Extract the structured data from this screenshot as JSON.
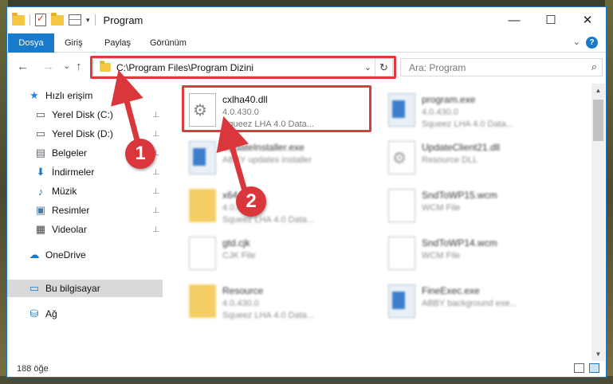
{
  "window": {
    "title": "Program",
    "controls": {
      "minimize": "—",
      "maximize": "☐",
      "close": "✕"
    }
  },
  "ribbon": {
    "tabs": [
      "Dosya",
      "Giriş",
      "Paylaş",
      "Görünüm"
    ],
    "expand_icon": "chevron-down-icon",
    "help_label": "?"
  },
  "navigation": {
    "back": "←",
    "forward": "→",
    "recent": "⌄",
    "up": "↑",
    "address": "C:\\Program Files\\Program Dizini",
    "refresh": "↻",
    "search_placeholder": "Ara: Program",
    "search_icon": "⌕"
  },
  "sidebar": {
    "items": [
      {
        "label": "Hızlı erişim",
        "icon": "star-icon",
        "glyph": "★",
        "pinned": false
      },
      {
        "label": "Yerel Disk (C:)",
        "icon": "drive-icon",
        "glyph": "▭",
        "pinned": true
      },
      {
        "label": "Yerel Disk (D:)",
        "icon": "drive-icon",
        "glyph": "▭",
        "pinned": true
      },
      {
        "label": "Belgeler",
        "icon": "documents-icon",
        "glyph": "▤",
        "pinned": true
      },
      {
        "label": "İndirmeler",
        "icon": "downloads-icon",
        "glyph": "⬇",
        "pinned": true
      },
      {
        "label": "Müzik",
        "icon": "music-icon",
        "glyph": "♪",
        "pinned": true
      },
      {
        "label": "Resimler",
        "icon": "pictures-icon",
        "glyph": "▣",
        "pinned": true
      },
      {
        "label": "Videolar",
        "icon": "videos-icon",
        "glyph": "▦",
        "pinned": true
      },
      {
        "label": "OneDrive",
        "icon": "onedrive-icon",
        "glyph": "☁",
        "pinned": false
      },
      {
        "label": "Bu bilgisayar",
        "icon": "computer-icon",
        "glyph": "▭",
        "pinned": false
      },
      {
        "label": "Ağ",
        "icon": "network-icon",
        "glyph": "⛁",
        "pinned": false
      }
    ],
    "pin_glyph": "⊥"
  },
  "files": [
    {
      "name": "cxlha40.dll",
      "line1": "4.0.430.0",
      "line2": "Squeez LHA 4.0 Data...",
      "type": "dll"
    },
    {
      "name": "program.exe",
      "line1": "4.0.430.0",
      "line2": "Squeez LHA 4.0 Data...",
      "type": "exe"
    },
    {
      "name": "UpdateInstaller.exe",
      "line1": "ABBY updates installer",
      "line2": "",
      "type": "exe"
    },
    {
      "name": "UpdateClient21.dll",
      "line1": "Resource DLL",
      "line2": "",
      "type": "dll"
    },
    {
      "name": "x64",
      "line1": "4.0.430.0",
      "line2": "Squeez LHA 4.0 Data...",
      "type": "folder"
    },
    {
      "name": "SndToWP15.wcm",
      "line1": "WCM File",
      "line2": "",
      "type": "doc"
    },
    {
      "name": "gtd.cjk",
      "line1": "CJK File",
      "line2": "",
      "type": "doc"
    },
    {
      "name": "SndToWP14.wcm",
      "line1": "WCM File",
      "line2": "",
      "type": "doc"
    },
    {
      "name": "Resource",
      "line1": "4.0.430.0",
      "line2": "Squeez LHA 4.0 Data...",
      "type": "folder"
    },
    {
      "name": "FineExec.exe",
      "line1": "ABBY background exe...",
      "line2": "",
      "type": "exe"
    }
  ],
  "scrollbar": {
    "up": "▲",
    "down": "▼"
  },
  "status": {
    "count": "188 öğe"
  },
  "annotations": {
    "marker1": "1",
    "marker2": "2",
    "highlight_color": "#e0393e"
  },
  "colors": {
    "accent": "#1979ca",
    "highlight": "#e0393e"
  }
}
